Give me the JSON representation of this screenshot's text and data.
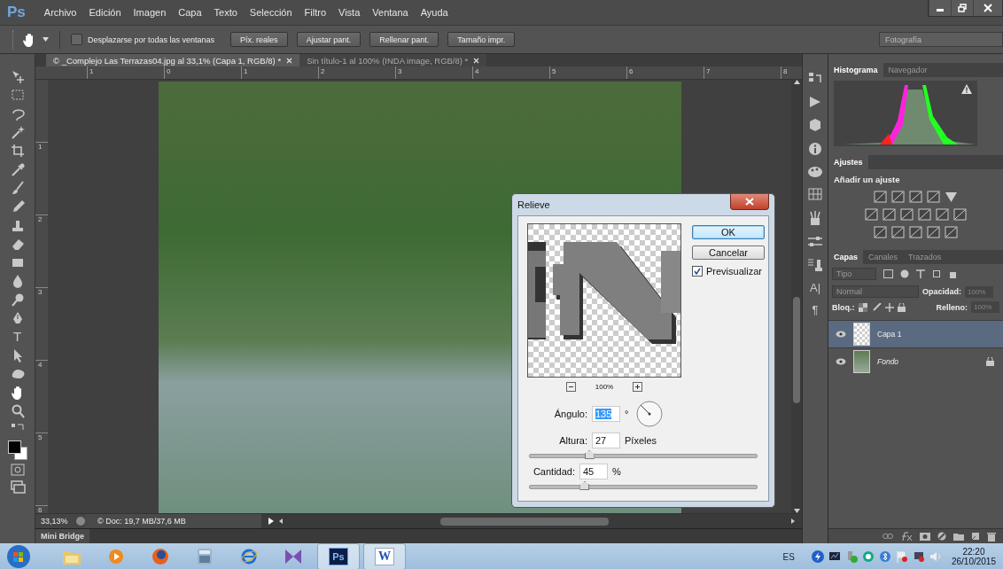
{
  "app_logo": "Ps",
  "menu": [
    "Archivo",
    "Edición",
    "Imagen",
    "Capa",
    "Texto",
    "Selección",
    "Filtro",
    "Vista",
    "Ventana",
    "Ayuda"
  ],
  "options_bar": {
    "scroll_all": {
      "label": "Desplazarse por todas las ventanas",
      "checked": false
    },
    "buttons": [
      "Píx. reales",
      "Ajustar pant.",
      "Rellenar pant.",
      "Tamaño impr."
    ],
    "workspace": "Fotografía"
  },
  "doc_tabs": [
    {
      "title": "© _Complejo Las Terrazas04.jpg al 33,1% (Capa 1, RGB/8) *",
      "selected": true
    },
    {
      "title": "Sin título-1 al 100% (INDA image, RGB/8) *",
      "selected": false
    }
  ],
  "ruler": {
    "horizontal": [
      "1",
      "0",
      "1",
      "2",
      "3",
      "4",
      "5",
      "6",
      "7",
      "8"
    ],
    "vertical": [
      "1",
      "2",
      "3",
      "4",
      "5",
      "6"
    ]
  },
  "toolbox": {
    "type_glyph": "T"
  },
  "status_bar": {
    "zoom": "33,13%",
    "doc_info": "© Doc: 19,7 MB/37,6 MB"
  },
  "mini_bridge": "Mini Bridge",
  "dock_glyphs": [
    "A|",
    "¶"
  ],
  "histogram": {
    "tabs": [
      {
        "label": "Histograma",
        "selected": true
      },
      {
        "label": "Navegador",
        "selected": false
      }
    ]
  },
  "adjustments": {
    "tab": "Ajustes",
    "heading": "Añadir un ajuste"
  },
  "layers": {
    "tabs": [
      {
        "label": "Capas",
        "selected": true
      },
      {
        "label": "Canales",
        "selected": false
      },
      {
        "label": "Trazados",
        "selected": false
      }
    ],
    "filter": "Tipo",
    "blend_mode": "Normal",
    "opacity_label": "Opacidad:",
    "opacity": "100%",
    "lock_label": "Bloq.:",
    "fill_label": "Relleno:",
    "fill": "100%",
    "items": [
      {
        "name": "Capa 1",
        "kind": "layer",
        "selected": true
      },
      {
        "name": "Fondo",
        "kind": "background",
        "selected": false
      }
    ]
  },
  "dialog": {
    "title": "Relieve",
    "preview_zoom": "100%",
    "buttons": [
      {
        "label": "OK",
        "default": true
      },
      {
        "label": "Cancelar",
        "default": false
      }
    ],
    "preview": {
      "label": "Previsualizar",
      "checked": true
    },
    "angle": {
      "label": "Ángulo:",
      "value": "135",
      "unit": "°"
    },
    "height": {
      "label": "Altura:",
      "value": "27",
      "unit": "Píxeles",
      "level": 0.26
    },
    "amount": {
      "label": "Cantidad:",
      "value": "45",
      "unit": "%",
      "level": 0.24
    }
  },
  "taskbar": {
    "apps": [
      {
        "kind": "folder",
        "running": false
      },
      {
        "kind": "media",
        "running": false
      },
      {
        "kind": "browser",
        "running": false
      },
      {
        "kind": "calculator",
        "running": false
      },
      {
        "kind": "ie",
        "running": false
      },
      {
        "kind": "studio",
        "running": false
      },
      {
        "kind": "ps",
        "label": "Ps",
        "running": true
      },
      {
        "kind": "word",
        "label": "W",
        "running": true
      }
    ],
    "language": "ES",
    "time": "22:20",
    "date": "26/10/2015"
  }
}
